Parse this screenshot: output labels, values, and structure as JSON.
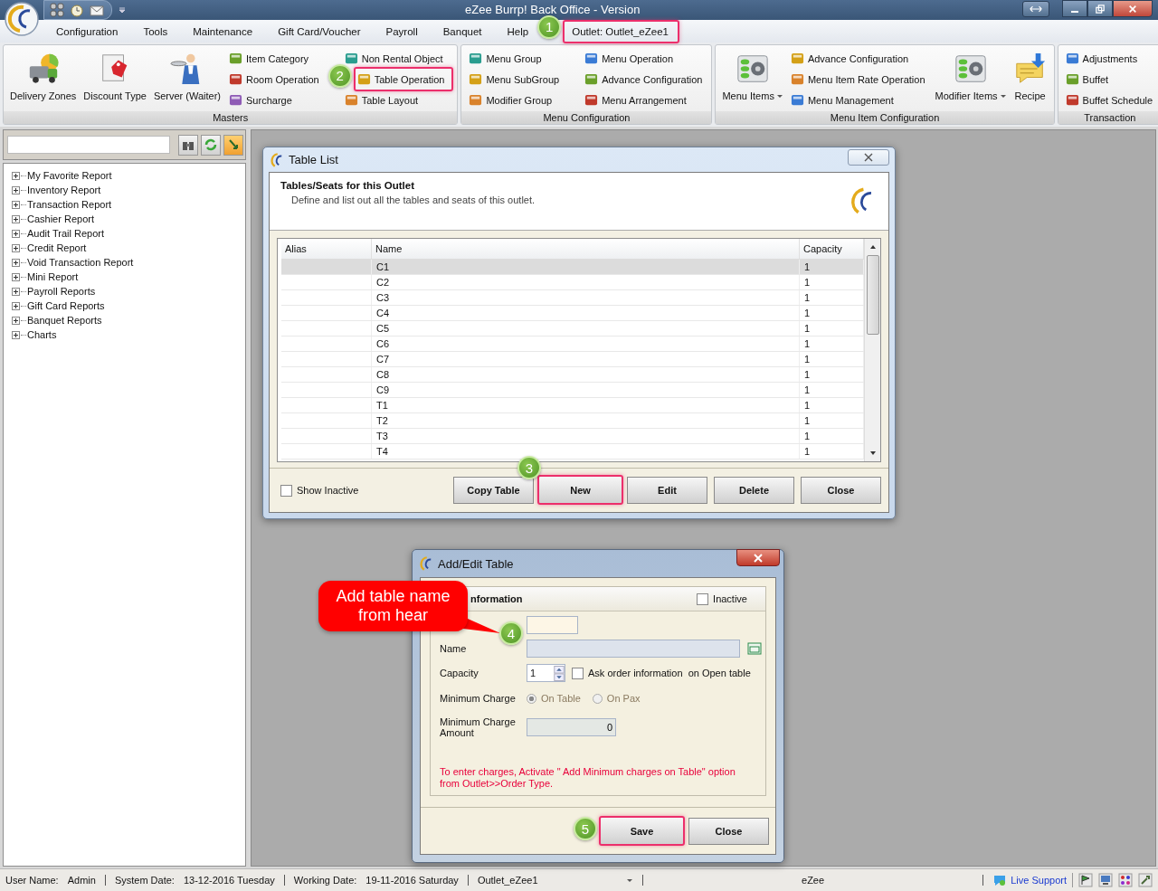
{
  "title_bar": {
    "title": "eZee Burrp! Back Office - Version"
  },
  "menu": [
    {
      "label": "Configuration"
    },
    {
      "label": "Tools"
    },
    {
      "label": "Maintenance"
    },
    {
      "label": "Gift Card/Voucher"
    },
    {
      "label": "Payroll"
    },
    {
      "label": "Banquet"
    },
    {
      "label": "Help"
    },
    {
      "label": "Outlet: Outlet_eZee1",
      "step": "1"
    }
  ],
  "ribbon": {
    "groups": [
      {
        "title": "Masters",
        "items": [
          {
            "kind": "large",
            "label": "Delivery Zones",
            "dropdown": false
          },
          {
            "kind": "large",
            "label": "Discount Type",
            "dropdown": false
          },
          {
            "kind": "large",
            "label": "Server (Waiter)",
            "dropdown": false
          },
          {
            "kind": "stack",
            "entries": [
              {
                "label": "Item Category"
              },
              {
                "label": "Room Operation"
              },
              {
                "label": "Surcharge"
              }
            ]
          },
          {
            "kind": "stack",
            "entries": [
              {
                "label": "Non Rental Object"
              },
              {
                "label": "Table Operation",
                "step": "2"
              },
              {
                "label": "Table Layout"
              }
            ]
          }
        ]
      },
      {
        "title": "Menu Configuration",
        "items": [
          {
            "kind": "stack",
            "entries": [
              {
                "label": "Menu Group"
              },
              {
                "label": "Menu SubGroup"
              },
              {
                "label": "Modifier Group"
              }
            ]
          },
          {
            "kind": "stack",
            "entries": [
              {
                "label": "Menu Operation"
              },
              {
                "label": "Advance Configuration"
              },
              {
                "label": "Menu Arrangement"
              }
            ]
          }
        ]
      },
      {
        "title": "Menu Item Configuration",
        "items": [
          {
            "kind": "large",
            "label": "Menu Items",
            "dropdown": true
          },
          {
            "kind": "stack",
            "entries": [
              {
                "label": "Advance Configuration"
              },
              {
                "label": "Menu Item Rate Operation"
              },
              {
                "label": "Menu Management"
              }
            ]
          },
          {
            "kind": "large",
            "label": "Modifier Items",
            "dropdown": true
          },
          {
            "kind": "large",
            "label": "Recipe",
            "dropdown": false
          }
        ]
      },
      {
        "title": "Transaction",
        "items": [
          {
            "kind": "stack",
            "entries": [
              {
                "label": "Adjustments"
              },
              {
                "label": "Buffet"
              },
              {
                "label": "Buffet Schedule"
              }
            ]
          }
        ]
      }
    ]
  },
  "report_tree": [
    {
      "label": "My Favorite Report",
      "expanded": false
    },
    {
      "label": "Inventory Report",
      "expanded": false
    },
    {
      "label": "Transaction Report",
      "expanded": false
    },
    {
      "label": "Cashier Report",
      "expanded": false
    },
    {
      "label": "Audit Trail Report",
      "expanded": false
    },
    {
      "label": "Credit Report",
      "expanded": false
    },
    {
      "label": "Void Transaction Report",
      "expanded": false
    },
    {
      "label": "Mini Report",
      "expanded": false
    },
    {
      "label": "Payroll Reports",
      "expanded": false
    },
    {
      "label": "Gift Card Reports",
      "expanded": false
    },
    {
      "label": "Banquet Reports",
      "expanded": false
    },
    {
      "label": "Charts",
      "expanded": false
    }
  ],
  "table_list": {
    "title": "Table List",
    "heading": "Tables/Seats for this Outlet",
    "description": "Define and list out all the tables and seats of this outlet.",
    "columns": [
      "Alias",
      "Name",
      "Capacity"
    ],
    "rows": [
      {
        "name": "C1",
        "capacity": "1",
        "selected": true
      },
      {
        "name": "C2",
        "capacity": "1",
        "selected": false
      },
      {
        "name": "C3",
        "capacity": "1",
        "selected": false
      },
      {
        "name": "C4",
        "capacity": "1",
        "selected": false
      },
      {
        "name": "C5",
        "capacity": "1",
        "selected": false
      },
      {
        "name": "C6",
        "capacity": "1",
        "selected": false
      },
      {
        "name": "C7",
        "capacity": "1",
        "selected": false
      },
      {
        "name": "C8",
        "capacity": "1",
        "selected": false
      },
      {
        "name": "C9",
        "capacity": "1",
        "selected": false
      },
      {
        "name": "T1",
        "capacity": "1",
        "selected": false
      },
      {
        "name": "T2",
        "capacity": "1",
        "selected": false
      },
      {
        "name": "T3",
        "capacity": "1",
        "selected": false
      },
      {
        "name": "T4",
        "capacity": "1",
        "selected": false
      }
    ],
    "show_inactive": {
      "label": "Show Inactive",
      "checked": false
    },
    "buttons": [
      {
        "label": "Copy Table"
      },
      {
        "label": "New",
        "step": "3"
      },
      {
        "label": "Edit"
      },
      {
        "label": "Delete"
      },
      {
        "label": "Close"
      }
    ]
  },
  "add_edit_table": {
    "title": "Add/Edit Table",
    "section": "nformation",
    "inactive": {
      "label": "Inactive",
      "checked": false
    },
    "name_label": "Name",
    "capacity_label": "Capacity",
    "capacity": "1",
    "ask_order": {
      "label": "Ask order information  on Open table",
      "checked": false
    },
    "minimum_charge_label": "Minimum Charge",
    "minimum_charge_options": [
      {
        "label": "On Table",
        "selected": true
      },
      {
        "label": "On Pax",
        "selected": false
      }
    ],
    "amount_label": "Minimum Charge Amount",
    "amount": "0",
    "note": "To enter charges, Activate \" Add Minimum charges on Table\" option from Outlet>>Order Type.",
    "buttons": [
      {
        "label": "Save",
        "step": "5"
      },
      {
        "label": "Close"
      }
    ],
    "callout": {
      "text": "Add table name from hear",
      "step": "4"
    }
  },
  "status_bar": {
    "fields": [
      {
        "label": "User Name:",
        "value": "Admin"
      },
      {
        "label": "System Date:",
        "value": "13-12-2016 Tuesday"
      },
      {
        "label": "Working Date:",
        "value": "19-11-2016 Saturday"
      }
    ],
    "outlet": "Outlet_eZee1",
    "center": "eZee",
    "live_support": "Live Support"
  }
}
